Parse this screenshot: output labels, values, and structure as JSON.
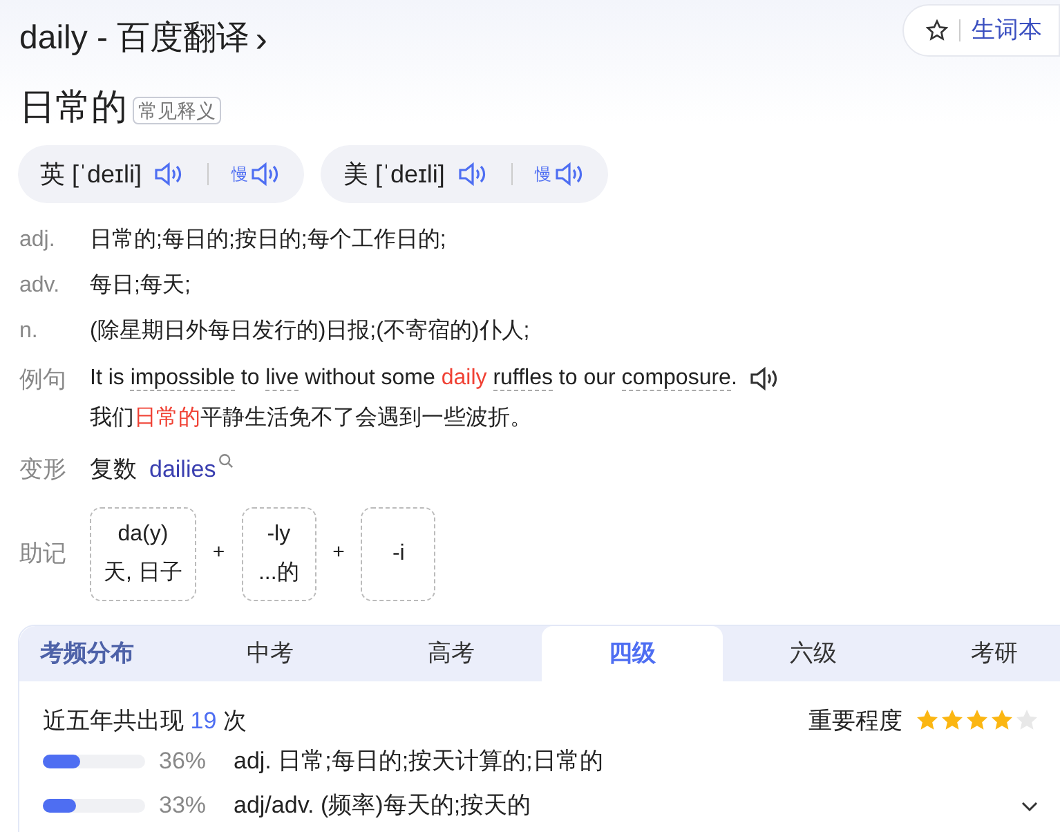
{
  "header": {
    "title": "daily - 百度翻译",
    "chevron": "›",
    "vocab_button": "生词本"
  },
  "headword": {
    "word": "日常的",
    "badge": "常见释义"
  },
  "pronunciations": [
    {
      "label": "英",
      "ipa": "[ˈdeɪli]",
      "slow": "慢"
    },
    {
      "label": "美",
      "ipa": "[ˈdeɪli]",
      "slow": "慢"
    }
  ],
  "definitions": [
    {
      "pos": "adj.",
      "text": "日常的;每日的;按日的;每个工作日的;"
    },
    {
      "pos": "adv.",
      "text": "每日;每天;"
    },
    {
      "pos": "n.",
      "text": "(除星期日外每日发行的)日报;(不寄宿的)仆人;"
    }
  ],
  "example": {
    "label": "例句",
    "sentence": [
      {
        "kind": "plain",
        "text": "It is "
      },
      {
        "kind": "underlined",
        "text": "impossible"
      },
      {
        "kind": "plain",
        "text": " to "
      },
      {
        "kind": "underlined",
        "text": "live"
      },
      {
        "kind": "plain",
        "text": " without some "
      },
      {
        "kind": "highlight",
        "text": "daily "
      },
      {
        "kind": "underlined",
        "text": "ruffles"
      },
      {
        "kind": "plain",
        "text": " to our "
      },
      {
        "kind": "underlined",
        "text": "composure"
      },
      {
        "kind": "plain",
        "text": "."
      }
    ],
    "translation": [
      {
        "kind": "plain",
        "text": "我们"
      },
      {
        "kind": "highlight",
        "text": "日常的"
      },
      {
        "kind": "plain",
        "text": "平静生活免不了会遇到一些波折。"
      }
    ]
  },
  "inflection": {
    "label": "变形",
    "type": "复数",
    "form": "dailies"
  },
  "mnemonic": {
    "label": "助记",
    "plus": "+",
    "parts": [
      {
        "top": "da(y)",
        "bottom": "天, 日子"
      },
      {
        "top": "-ly",
        "bottom": "...的"
      },
      {
        "top": "-i"
      }
    ]
  },
  "exam_frequency": {
    "title": "考频分布",
    "tabs": [
      {
        "label": "中考",
        "selected": false
      },
      {
        "label": "高考",
        "selected": false
      },
      {
        "label": "四级",
        "selected": true
      },
      {
        "label": "六级",
        "selected": false
      },
      {
        "label": "考研",
        "selected": false
      }
    ],
    "count_prefix": "近五年共出现",
    "count": "19",
    "count_suffix": "次",
    "importance_label": "重要程度",
    "stars": 4,
    "senses": [
      {
        "level": 0.36,
        "percent": "36%",
        "text": "adj. 日常;每日的;按天计算的;日常的"
      },
      {
        "level": 0.33,
        "percent": "33%",
        "text": "adj/adv. (频率)每天的;按天的"
      }
    ]
  }
}
